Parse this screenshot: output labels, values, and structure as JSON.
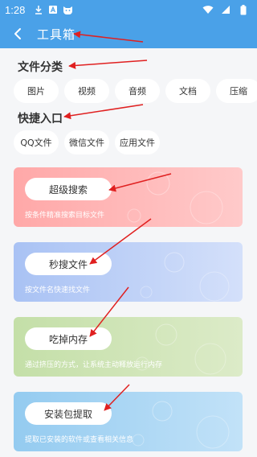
{
  "status_bar": {
    "time": "1:28",
    "icons": [
      "download-icon",
      "font-icon",
      "cat-icon",
      "wifi-icon",
      "signal-icon",
      "battery-icon"
    ]
  },
  "app_bar": {
    "title": "工具箱",
    "back_icon": "chevron-left-icon"
  },
  "file_category": {
    "title": "文件分类",
    "chips": [
      "图片",
      "视频",
      "音频",
      "文档",
      "压缩"
    ]
  },
  "quick_access": {
    "title": "快捷入口",
    "chips": [
      "QQ文件",
      "微信文件",
      "应用文件"
    ]
  },
  "tools": [
    {
      "label": "超级搜索",
      "desc": "按条件精准搜索目标文件",
      "color": "#ffb2b2"
    },
    {
      "label": "秒搜文件",
      "desc": "按文件名快速找文件",
      "color": "#b7cdf6"
    },
    {
      "label": "吃掉内存",
      "desc": "通过挤压的方式，让系统主动释放运行内存",
      "color": "#cde4b6"
    },
    {
      "label": "安装包提取",
      "desc": "提取已安装的软件或查看相关信息",
      "color": "#a6d4f2"
    }
  ],
  "colors": {
    "primary": "#4aa1e8",
    "background": "#f5f6f8",
    "annotation_arrow": "#e02020"
  }
}
